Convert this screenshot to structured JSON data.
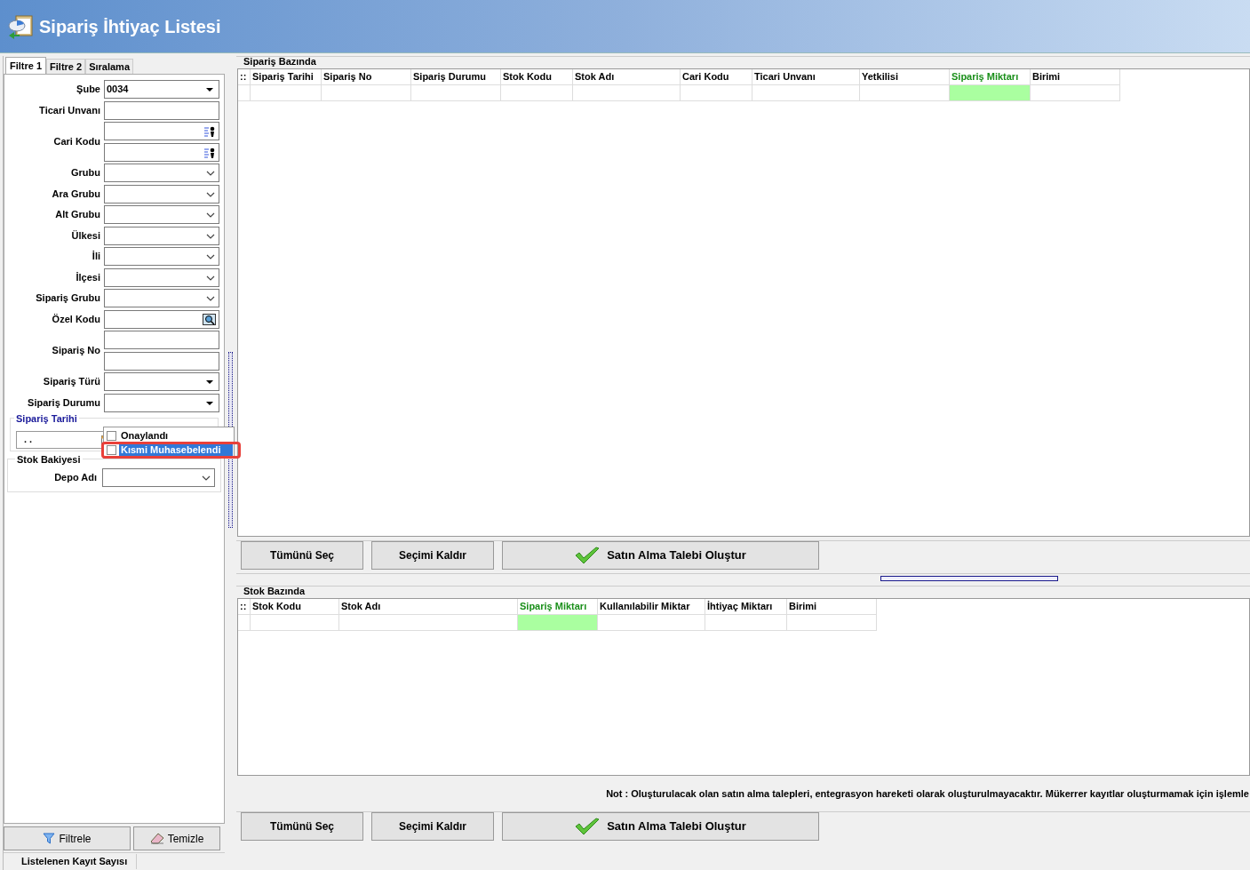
{
  "window": {
    "title": "Sipariş İhtiyaç Listesi"
  },
  "filter_tabs": [
    {
      "label": "Filtre 1",
      "selected": true
    },
    {
      "label": "Filtre 2",
      "selected": false
    },
    {
      "label": "Sıralama",
      "selected": false
    }
  ],
  "filters": [
    {
      "label": "Şube",
      "kind": "dropdown",
      "value": "0034"
    },
    {
      "label": "Ticari Unvanı",
      "kind": "text"
    },
    {
      "label": "Cari Kodu",
      "kind": "lookup-pair"
    },
    {
      "label": "Grubu",
      "kind": "combo"
    },
    {
      "label": "Ara Grubu",
      "kind": "combo"
    },
    {
      "label": "Alt Grubu",
      "kind": "combo"
    },
    {
      "label": "Ülkesi",
      "kind": "combo"
    },
    {
      "label": "İli",
      "kind": "combo"
    },
    {
      "label": "İlçesi",
      "kind": "combo"
    },
    {
      "label": "Sipariş Grubu",
      "kind": "combo"
    },
    {
      "label": "Özel Kodu",
      "kind": "search"
    },
    {
      "label": "Sipariş No",
      "kind": "text-pair"
    },
    {
      "label": "Sipariş Türü",
      "kind": "dropdown"
    },
    {
      "label": "Sipariş Durumu",
      "kind": "dropdown"
    }
  ],
  "status_popup": {
    "options": [
      {
        "label": "Onaylandı",
        "checked": false,
        "selected": false,
        "annotated": false
      },
      {
        "label": "Kısmi Muhasebelendi",
        "checked": false,
        "selected": true,
        "annotated": true
      }
    ]
  },
  "date_group": {
    "title": "Sipariş Tarihi",
    "start": ". ."
  },
  "stock_balance_group": {
    "title": "Stok Bakiyesi",
    "fields": [
      {
        "label": "Depo Adı",
        "kind": "combo"
      }
    ]
  },
  "filter_buttons": [
    {
      "label": "Filtrele",
      "kind": "filter"
    },
    {
      "label": "Temizle",
      "kind": "clear"
    }
  ],
  "status_bar": {
    "text": "Listelenen Kayıt Sayısı"
  },
  "order_grid": {
    "title": "Sipariş Bazında",
    "handle": "::",
    "columns": [
      {
        "label": "Sipariş Tarihi",
        "highlighted": false
      },
      {
        "label": "Sipariş No",
        "highlighted": false
      },
      {
        "label": "Sipariş Durumu",
        "highlighted": false
      },
      {
        "label": "Stok Kodu",
        "highlighted": false
      },
      {
        "label": "Stok Adı",
        "highlighted": false
      },
      {
        "label": "Cari Kodu",
        "highlighted": false
      },
      {
        "label": "Ticari Unvanı",
        "highlighted": false
      },
      {
        "label": "Yetkilisi",
        "highlighted": false
      },
      {
        "label": "Sipariş Miktarı",
        "highlighted": true
      },
      {
        "label": "Birimi",
        "highlighted": false
      }
    ],
    "actions": [
      "Tümünü Seç",
      "Seçimi Kaldır",
      "Satın Alma Talebi Oluştur"
    ]
  },
  "stock_grid": {
    "title": "Stok Bazında",
    "handle": "::",
    "columns": [
      {
        "label": "Stok Kodu",
        "highlighted": false
      },
      {
        "label": "Stok Adı",
        "highlighted": false
      },
      {
        "label": "Sipariş Miktarı",
        "highlighted": true
      },
      {
        "label": "Kullanılabilir Miktar",
        "highlighted": false
      },
      {
        "label": "İhtiyaç Miktarı",
        "highlighted": false
      },
      {
        "label": "Birimi",
        "highlighted": false
      }
    ],
    "note": "Not : Oluşturulacak olan satın alma talepleri, entegrasyon hareketi olarak oluşturulmayacaktır. Mükerrer kayıtlar oluşturmamak için işlemle",
    "actions": [
      "Tümünü Seç",
      "Seçimi Kaldır",
      "Satın Alma Talebi Oluştur"
    ]
  }
}
